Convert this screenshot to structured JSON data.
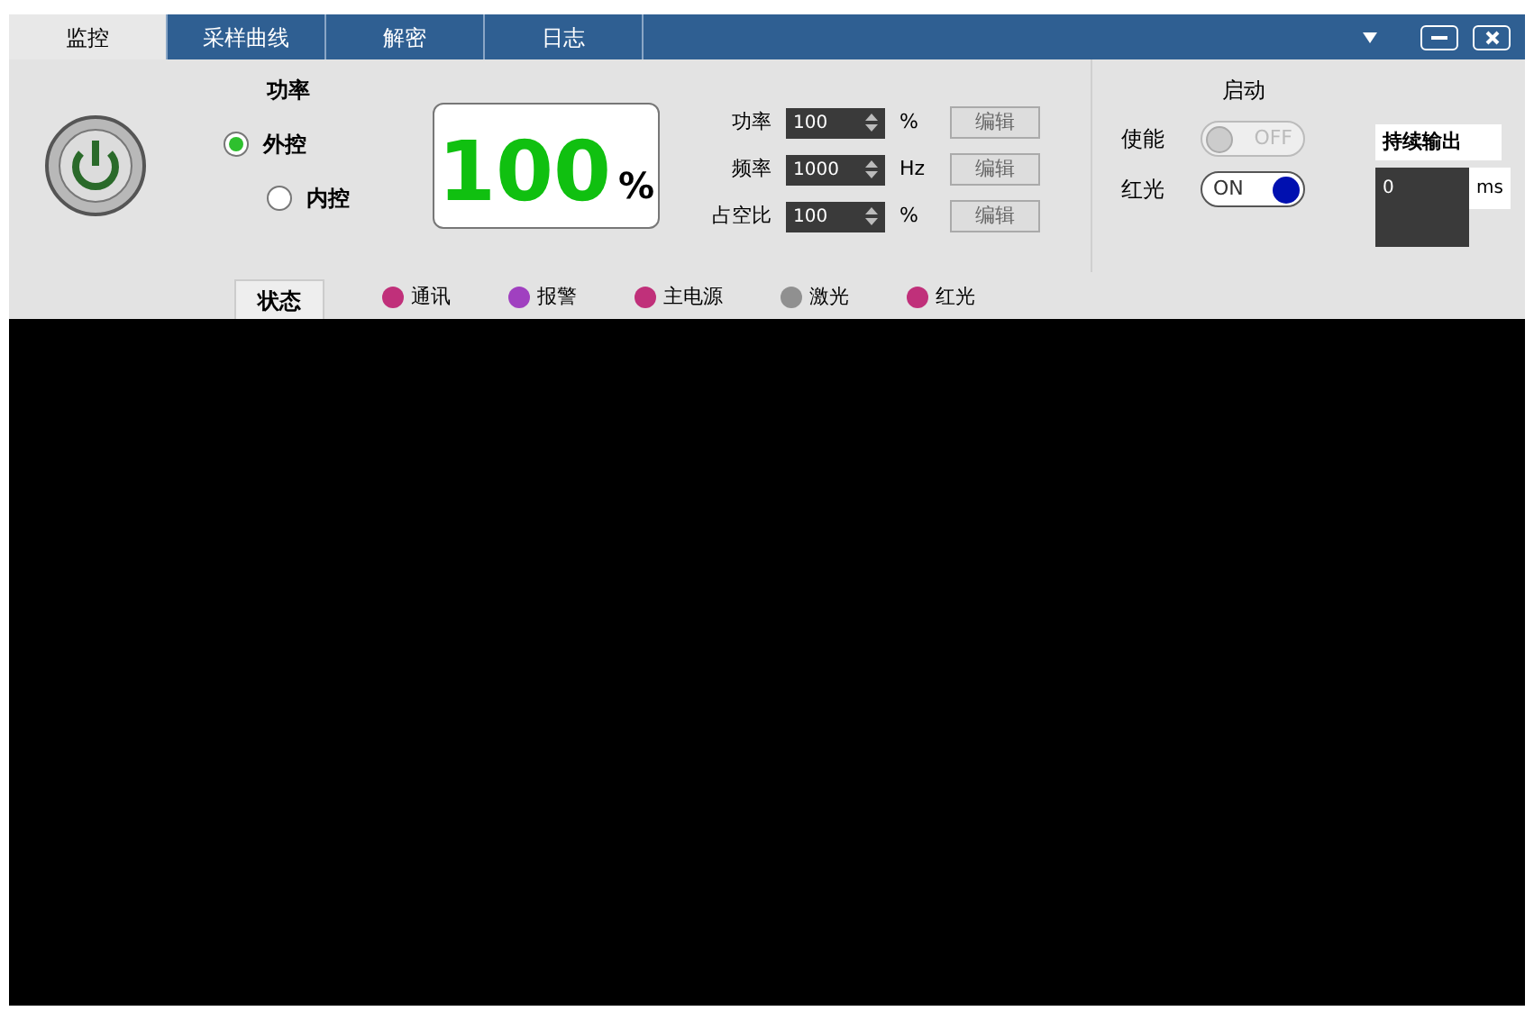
{
  "tabs": [
    {
      "label": "监控",
      "selected": true
    },
    {
      "label": "采样曲线",
      "selected": false
    },
    {
      "label": "解密",
      "selected": false
    },
    {
      "label": "日志",
      "selected": false
    }
  ],
  "power_mode": {
    "title": "功率",
    "options": [
      {
        "label": "外控",
        "selected": true
      },
      {
        "label": "内控",
        "selected": false
      }
    ]
  },
  "display": {
    "value": "100",
    "unit": "%"
  },
  "parameters": [
    {
      "label": "功率",
      "value": "100",
      "unit": "%",
      "button": "编辑"
    },
    {
      "label": "频率",
      "value": "1000",
      "unit": "Hz",
      "button": "编辑"
    },
    {
      "label": "占空比",
      "value": "100",
      "unit": "%",
      "button": "编辑"
    }
  ],
  "start": {
    "title": "启动",
    "switches": [
      {
        "label": "使能",
        "text": "OFF",
        "on": false
      },
      {
        "label": "红光",
        "text": "ON",
        "on": true
      }
    ]
  },
  "output": {
    "mode": "持续输出",
    "value": "0",
    "unit": "ms"
  },
  "status": {
    "tab": "状态",
    "items": [
      {
        "label": "通讯",
        "color": "#c0307a"
      },
      {
        "label": "报警",
        "color": "#a040c0"
      },
      {
        "label": "主电源",
        "color": "#c0307a"
      },
      {
        "label": "激光",
        "color": "#909090"
      },
      {
        "label": "红光",
        "color": "#c0307a"
      }
    ]
  }
}
